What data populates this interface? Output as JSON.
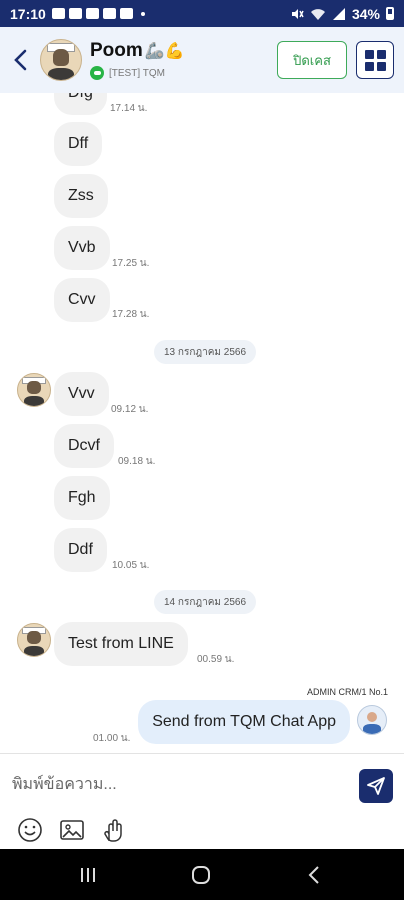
{
  "status_bar": {
    "time": "17:10",
    "battery": "34%"
  },
  "header": {
    "contact_name": "Poom",
    "contact_emoji": "🦾💪",
    "channel": "[TEST] TQM",
    "close_case_label": "ปิดเคส"
  },
  "messages": [
    {
      "text": "Dfg",
      "time": "17.14 น."
    },
    {
      "text": "Dff",
      "time": ""
    },
    {
      "text": "Zss",
      "time": ""
    },
    {
      "text": "Vvb",
      "time": "17.25 น."
    },
    {
      "text": "Cvv",
      "time": "17.28 น."
    },
    {
      "date": "13 กรกฎาคม 2566"
    },
    {
      "text": "Vvv",
      "time": "09.12 น."
    },
    {
      "text": "Dcvf",
      "time": "09.18 น."
    },
    {
      "text": "Fgh",
      "time": ""
    },
    {
      "text": "Ddf",
      "time": "10.05 น."
    },
    {
      "date": "14 กรกฎาคม 2566"
    },
    {
      "text": "Test from LINE",
      "time": "00.59 น."
    },
    {
      "text": "Send from TQM Chat App",
      "time": "01.00 น.",
      "agent": "ADMIN CRM/1 No.1"
    }
  ],
  "composer": {
    "placeholder": "พิมพ์ข้อความ..."
  },
  "colors": {
    "brand_navy": "#1a2d6e",
    "close_green": "#3eaa5a",
    "incoming_bubble": "#f1f1f1",
    "outgoing_bubble": "#e3eefb"
  },
  "icons": [
    "back-arrow-icon",
    "line-icon",
    "grid-menu-icon",
    "send-icon",
    "emoji-icon",
    "image-icon",
    "sticker-icon",
    "recent-apps-icon",
    "home-icon",
    "nav-back-icon"
  ]
}
